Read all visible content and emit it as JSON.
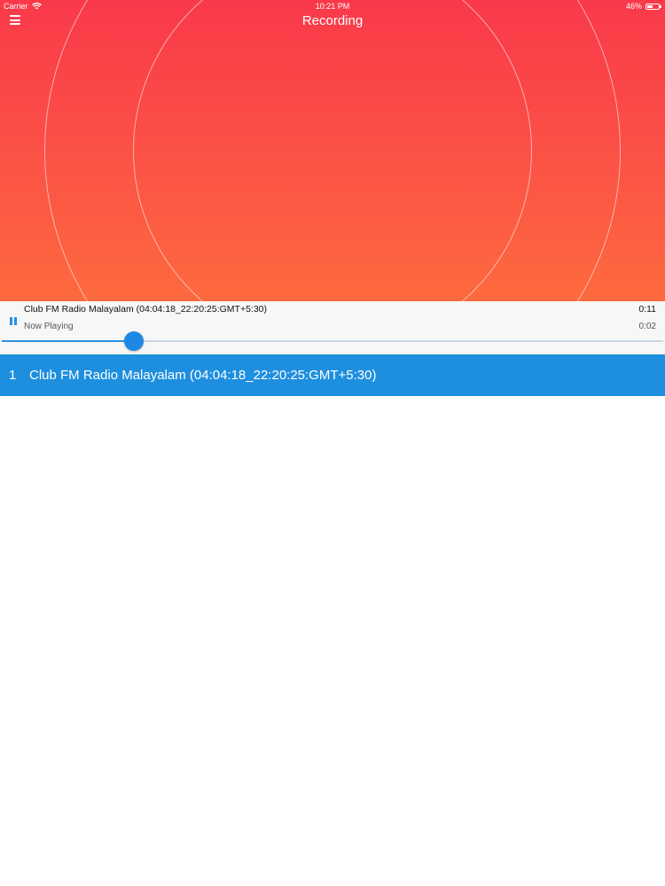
{
  "status_bar": {
    "carrier": "Carrier",
    "wifi_icon": "wifi-icon",
    "time": "10:21 PM",
    "battery_percent": "46%",
    "battery_level": 0.46
  },
  "nav": {
    "menu_icon": "hamburger-menu-icon",
    "title": "Recording"
  },
  "player": {
    "track_title": "Club FM Radio Malayalam (04:04:18_22:20:25:GMT+5:30)",
    "state_label": "Now Playing",
    "duration": "0:11",
    "elapsed": "0:02",
    "progress": 0.2,
    "pause_icon": "pause-icon"
  },
  "recordings": [
    {
      "index": "1",
      "title": "Club FM Radio Malayalam (04:04:18_22:20:25:GMT+5:30)"
    }
  ],
  "colors": {
    "gradient_top": "#f9394a",
    "gradient_bottom": "#fd6a3e",
    "accent": "#1e8fdf"
  }
}
